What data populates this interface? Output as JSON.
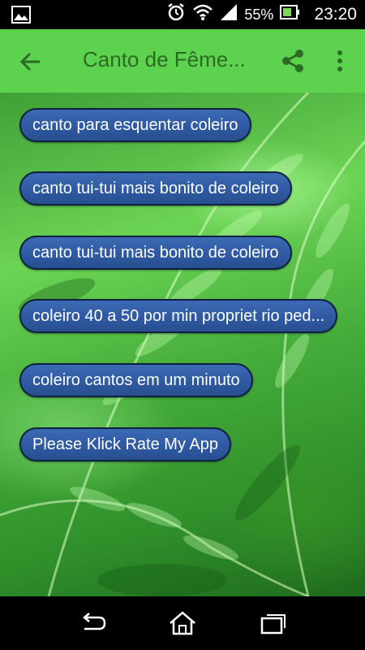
{
  "status_bar": {
    "battery_percent": "55%",
    "time": "23:20",
    "icons": [
      "image-icon",
      "alarm-icon",
      "wifi-icon",
      "signal-icon",
      "battery-icon"
    ]
  },
  "app_bar": {
    "title": "Canto de Fême...",
    "icons": [
      "back-arrow-icon",
      "share-icon",
      "more-vert-icon"
    ]
  },
  "items": [
    {
      "label": "canto para esquentar coleiro"
    },
    {
      "label": "canto tui-tui mais bonito de coleiro"
    },
    {
      "label": "canto tui-tui mais bonito de coleiro"
    },
    {
      "label": "coleiro 40 a 50 por min propriet rio ped..."
    },
    {
      "label": "coleiro cantos em um minuto"
    },
    {
      "label": "Please Klick Rate My App"
    }
  ],
  "nav_bar": {
    "icons": [
      "back-icon",
      "home-icon",
      "recents-icon"
    ]
  },
  "colors": {
    "app_bar": "#5cd24f",
    "title": "#2d6b23",
    "button_fill": "#2f5aa3",
    "button_border": "#0d2140"
  }
}
